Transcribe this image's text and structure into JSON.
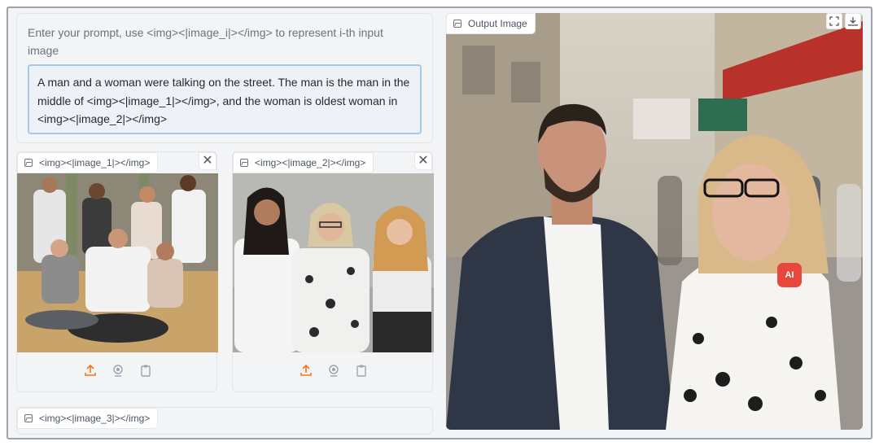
{
  "prompt": {
    "label": "Enter your prompt, use <img><|image_i|></img> to represent i-th input image",
    "value": "A man and a woman were talking on the street. The man is the man in the middle of <img><|image_1|></img>, and the woman is oldest woman in <img><|image_2|></img>"
  },
  "inputs": [
    {
      "label": "<img><|image_1|></img>",
      "close": "✕"
    },
    {
      "label": "<img><|image_2|></img>",
      "close": "✕"
    },
    {
      "label": "<img><|image_3|></img>"
    }
  ],
  "toolbar_icons": [
    "upload-icon",
    "webcam-icon",
    "clipboard-icon"
  ],
  "output": {
    "label": "Output Image",
    "actions": [
      "fullscreen-icon",
      "download-icon"
    ],
    "badge": "AI"
  },
  "colors": {
    "accent": "#f97316",
    "focus_border": "#a5c8f0",
    "panel_bg": "#f3f4f6"
  }
}
